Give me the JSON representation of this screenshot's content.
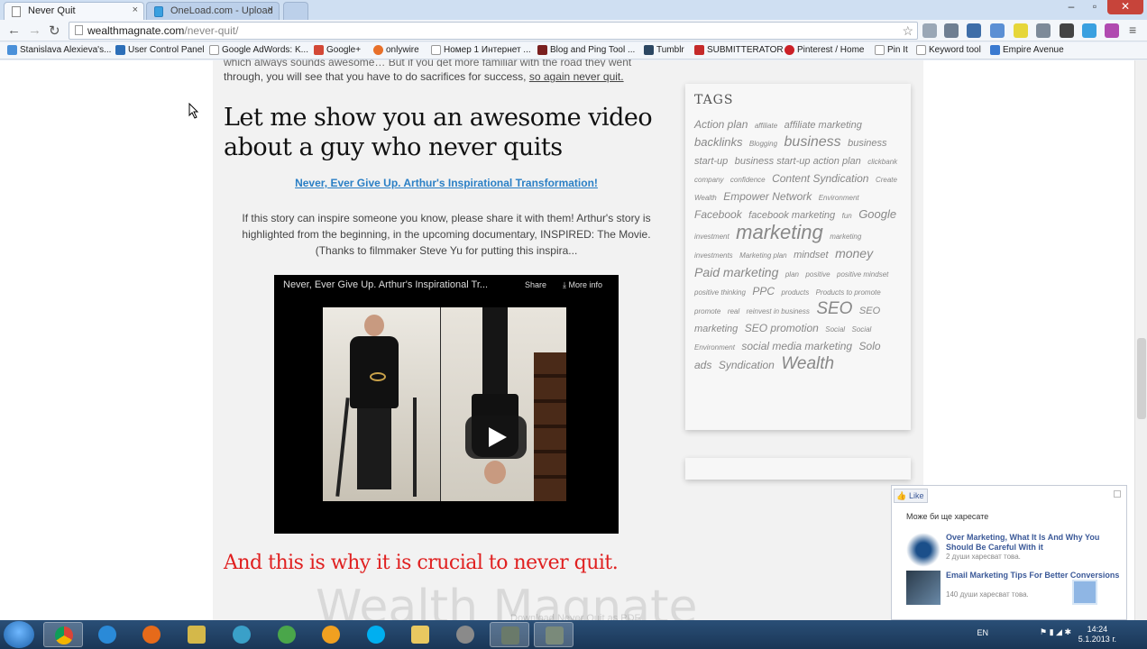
{
  "browser": {
    "tabs": [
      {
        "title": "Never Quit",
        "active": true
      },
      {
        "title": "OneLoad.com - Upload",
        "active": false
      }
    ],
    "url_main": "wealthmagnate.com",
    "url_path": "/never-quit/",
    "bookmarks": [
      "Stanislava Alexieva's...",
      "User Control Panel",
      "Google AdWords: K...",
      "Google+",
      "onlywire",
      "Номер 1 Интернет ...",
      "Blog and Ping Tool ...",
      "Tumblr",
      "SUBMITTERATOR",
      "Pinterest / Home",
      "Pin It",
      "Keyword tool",
      "Empire Avenue"
    ]
  },
  "article": {
    "intro_line1": "which always sounds awesome… But if you get more familiar with the road they went",
    "intro_line2": "through, you will see that you have to do sacrifices for success,",
    "intro_link": "so again never quit.",
    "heading": "Let me show you an awesome video about a guy who never quits",
    "video_link": "Never, Ever Give Up. Arthur's Inspirational Transformation!",
    "description": "If this story can inspire someone you know, please share it with them! Arthur's story is highlighted from the beginning, in the upcoming documentary, INSPIRED: The Movie. (Thanks to filmmaker Steve Yu for putting this inspira...",
    "video": {
      "title": "Never, Ever Give Up.  Arthur's Inspirational Tr...",
      "share": "Share",
      "more_info": "More info"
    },
    "closing": "And this is why it is crucial to never quit.",
    "watermark": "Wealth Magnate",
    "footer_link": "Download Never Quit as PDF"
  },
  "sidebar": {
    "title": "TAGS",
    "tags": [
      {
        "text": "Action plan",
        "size": 12
      },
      {
        "text": "affiliate",
        "size": 8
      },
      {
        "text": "affiliate marketing",
        "size": 11
      },
      {
        "text": "backlinks",
        "size": 13
      },
      {
        "text": "Blogging",
        "size": 8
      },
      {
        "text": "business",
        "size": 16
      },
      {
        "text": "business start-up",
        "size": 11
      },
      {
        "text": "business start-up action plan",
        "size": 11
      },
      {
        "text": "clickbank",
        "size": 8
      },
      {
        "text": "company",
        "size": 8
      },
      {
        "text": "confidence",
        "size": 8
      },
      {
        "text": "Content Syndication",
        "size": 12
      },
      {
        "text": "Create Wealth",
        "size": 8
      },
      {
        "text": "Empower Network",
        "size": 12
      },
      {
        "text": "Environment",
        "size": 8
      },
      {
        "text": "Facebook",
        "size": 12
      },
      {
        "text": "facebook marketing",
        "size": 11
      },
      {
        "text": "fun",
        "size": 8
      },
      {
        "text": "Google",
        "size": 13
      },
      {
        "text": "investment",
        "size": 8
      },
      {
        "text": "marketing",
        "size": 22
      },
      {
        "text": "marketing investments",
        "size": 8
      },
      {
        "text": "Marketing plan",
        "size": 8
      },
      {
        "text": "mindset",
        "size": 11
      },
      {
        "text": "money",
        "size": 14
      },
      {
        "text": "Paid marketing",
        "size": 14
      },
      {
        "text": "plan",
        "size": 8
      },
      {
        "text": "positive",
        "size": 8
      },
      {
        "text": "positive mindset",
        "size": 8
      },
      {
        "text": "positive thinking",
        "size": 8
      },
      {
        "text": "PPC",
        "size": 12
      },
      {
        "text": "products",
        "size": 8
      },
      {
        "text": "Products to promote",
        "size": 8
      },
      {
        "text": "promote",
        "size": 8
      },
      {
        "text": "real",
        "size": 8
      },
      {
        "text": "reinvest in business",
        "size": 8
      },
      {
        "text": "SEO",
        "size": 19
      },
      {
        "text": "SEO marketing",
        "size": 11
      },
      {
        "text": "SEO promotion",
        "size": 12
      },
      {
        "text": "Social",
        "size": 8
      },
      {
        "text": "Social Environment",
        "size": 8
      },
      {
        "text": "social media marketing",
        "size": 12
      },
      {
        "text": "Solo ads",
        "size": 12
      },
      {
        "text": "Syndication",
        "size": 12
      },
      {
        "text": "Wealth",
        "size": 19
      }
    ]
  },
  "facebook": {
    "like": "Like",
    "header": "Може би ще харесате",
    "items": [
      {
        "title": "Over Marketing, What It Is And Why You Should Be Careful With it",
        "count": "2 души харесват това."
      },
      {
        "title": "Email Marketing Tips For Better Conversions",
        "count": "140 души харесват това."
      }
    ]
  },
  "taskbar": {
    "lang": "EN",
    "time": "14:24",
    "date": "5.1.2013 г."
  }
}
